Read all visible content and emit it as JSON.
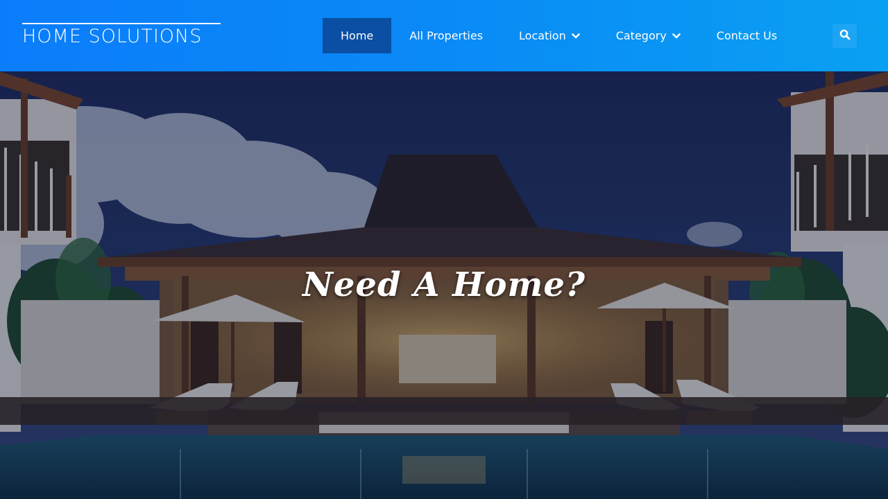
{
  "brand": {
    "name": "HOME SOLUTIONS"
  },
  "nav": {
    "items": [
      {
        "label": "Home",
        "active": true,
        "dropdown": false
      },
      {
        "label": "All Properties",
        "active": false,
        "dropdown": false
      },
      {
        "label": "Location",
        "active": false,
        "dropdown": true
      },
      {
        "label": "Category",
        "active": false,
        "dropdown": true
      },
      {
        "label": "Contact Us",
        "active": false,
        "dropdown": false
      }
    ],
    "search_icon": "search-icon"
  },
  "hero": {
    "title": "Need A Home?"
  },
  "colors": {
    "header_gradient_start": "#0b7dfb",
    "header_gradient_end": "#0aa0f2",
    "nav_active_bg": "#0a4fa3",
    "text": "#ffffff"
  }
}
